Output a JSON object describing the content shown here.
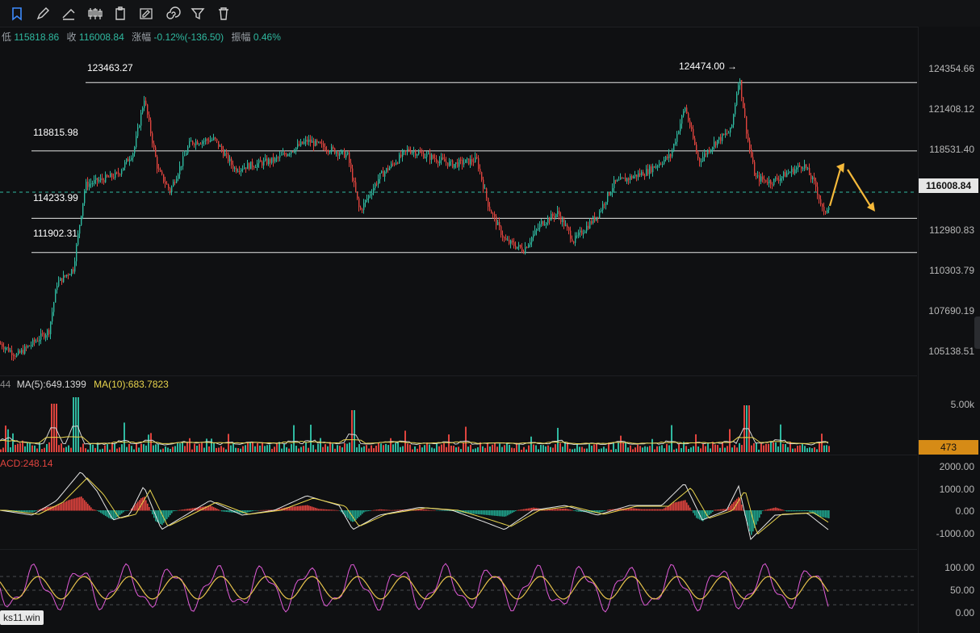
{
  "toolbar": {
    "tools": [
      "bookmark-icon",
      "pencil-icon",
      "ruler-icon",
      "candle-icon",
      "clipboard-icon",
      "note-edit-icon",
      "spiral-icon",
      "filter-icon",
      "trash-icon"
    ]
  },
  "stats": {
    "low_label": "低",
    "low_value": "115818.86",
    "close_label": "收",
    "close_value": "116008.84",
    "change_label": "涨幅",
    "change_value": "-0.12%(-136.50)",
    "amp_label": "振幅",
    "amp_value": "0.46%"
  },
  "price_levels": [
    {
      "label": "123463.27",
      "value": 123463.27
    },
    {
      "label": "118815.98",
      "value": 118815.98
    },
    {
      "label": "114233.99",
      "value": 114233.99
    },
    {
      "label": "111902.31",
      "value": 111902.31
    }
  ],
  "high_marker": {
    "label": "124474.00 →",
    "value": 124474.0
  },
  "current_price": {
    "label": "116008.84",
    "value": 116008.84,
    "color": "#2fb9a0"
  },
  "price_axis": [
    "124354.66",
    "121408.12",
    "118531.40",
    "112980.83",
    "110303.79",
    "107690.19",
    "105138.51"
  ],
  "volume": {
    "prefix": "44",
    "ma5_label": "MA(5):649.1399",
    "ma10_label": "MA(10):683.7823",
    "axis_top": "5.00k",
    "current_tag": "473",
    "ma5_color": "#d6d6d6",
    "ma10_color": "#e8d44d"
  },
  "macd": {
    "label": "ACD:248.14",
    "axis": [
      "2000.00",
      "1000.00",
      "0.00",
      "-1000.00"
    ],
    "up_color": "#e0443e",
    "down_color": "#1fa38c"
  },
  "osc": {
    "axis": [
      "100.00",
      "50.00",
      "0.00"
    ]
  },
  "watermark": "ks11.win",
  "colors": {
    "up": "#2fb9a0",
    "down": "#e0443e",
    "arrow": "#f5b93a",
    "k_line": "#e05bd8",
    "d_line": "#e8c34d"
  }
}
